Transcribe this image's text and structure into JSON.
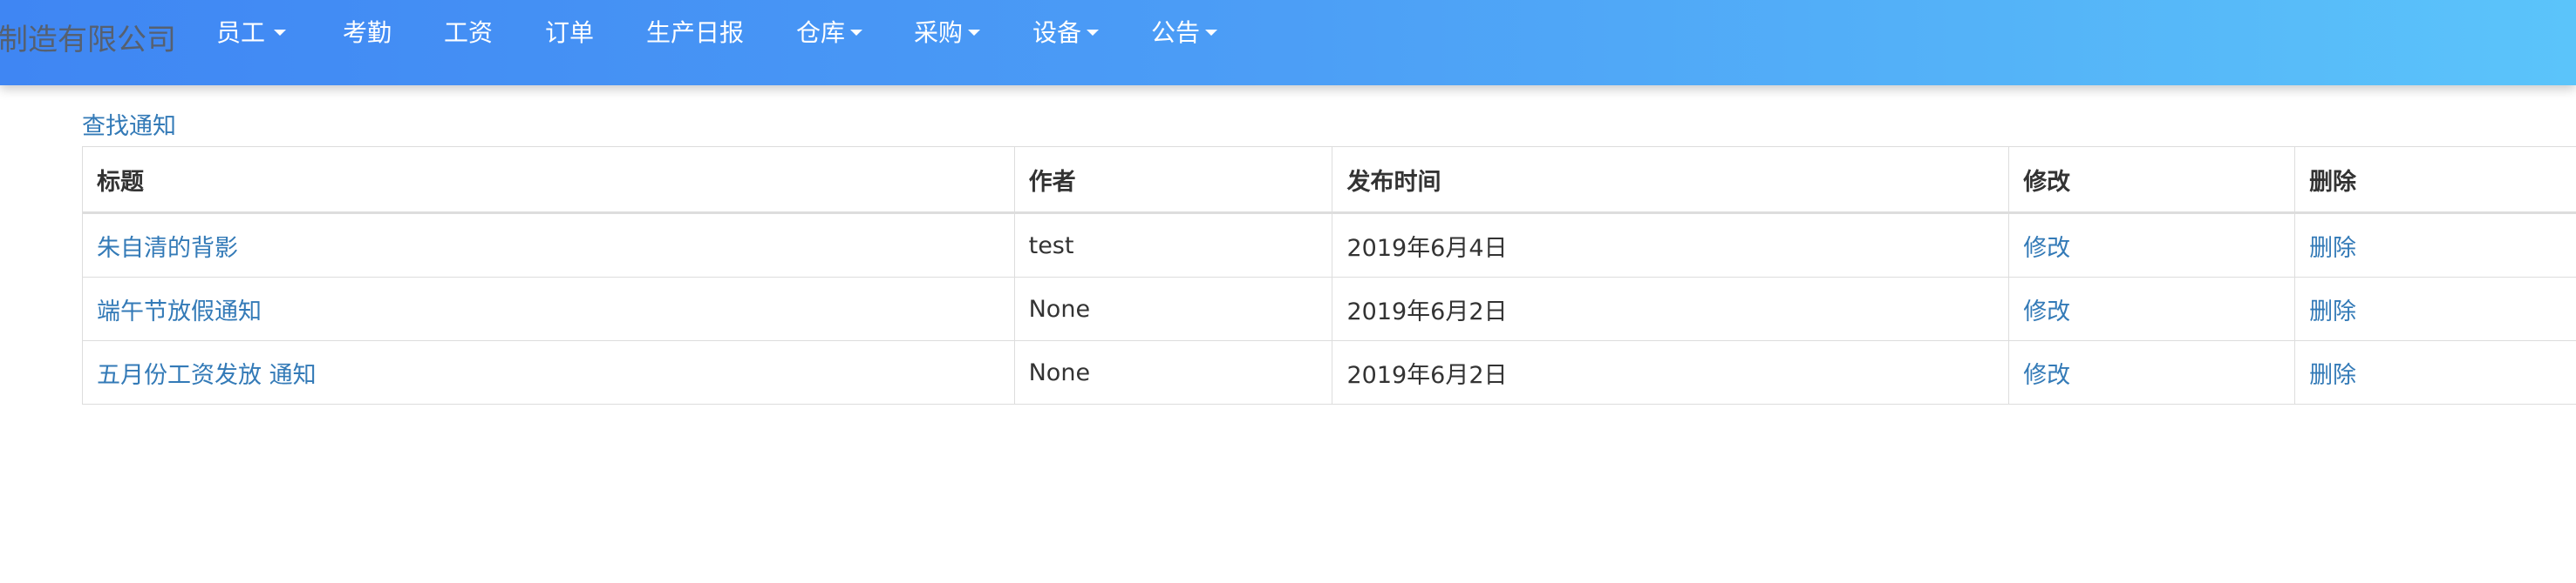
{
  "navbar": {
    "brand": "制造有限公司",
    "items": [
      {
        "label": "员工",
        "dropdown": true
      },
      {
        "label": "考勤",
        "dropdown": false
      },
      {
        "label": "工资",
        "dropdown": false
      },
      {
        "label": "订单",
        "dropdown": false
      },
      {
        "label": "生产日报",
        "dropdown": false
      },
      {
        "label": "仓库",
        "dropdown": true
      },
      {
        "label": "采购",
        "dropdown": true
      },
      {
        "label": "设备",
        "dropdown": true
      },
      {
        "label": "公告",
        "dropdown": true
      }
    ],
    "colors": {
      "gradient_start": "#3f86f3",
      "gradient_end": "#5bc4fa",
      "text": "#ffffff"
    }
  },
  "main": {
    "search_link": "查找通知",
    "table": {
      "headers": [
        "标题",
        "作者",
        "发布时间",
        "修改",
        "删除"
      ],
      "rows": [
        {
          "title": "朱自清的背影",
          "author": "test",
          "date": "2019年6月4日",
          "edit": "修改",
          "delete": "删除"
        },
        {
          "title": "端午节放假通知",
          "author": "None",
          "date": "2019年6月2日",
          "edit": "修改",
          "delete": "删除"
        },
        {
          "title": "五月份工资发放 通知",
          "author": "None",
          "date": "2019年6月2日",
          "edit": "修改",
          "delete": "删除"
        }
      ]
    },
    "colors": {
      "link": "#337ab7",
      "text": "#333333",
      "border": "#dddddd"
    }
  }
}
